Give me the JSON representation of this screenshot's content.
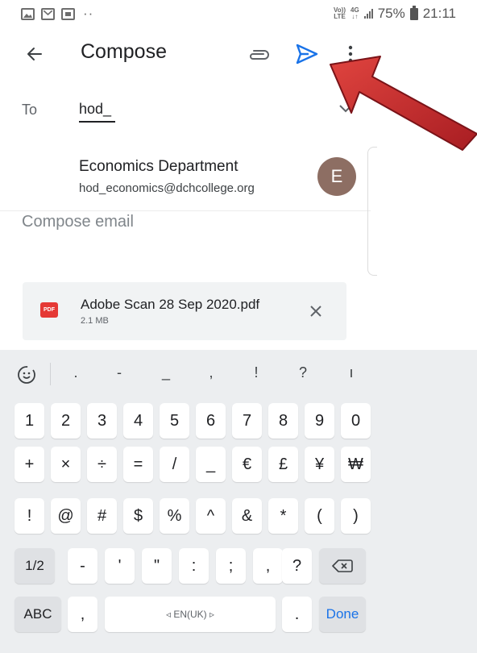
{
  "status_bar": {
    "net_tag_top": "Vo))",
    "net_tag_bottom": "LTE",
    "net_type": "4G",
    "battery": "75%",
    "time": "21:11",
    "left_icons": [
      "gallery-icon",
      "gmail-icon",
      "app-icon"
    ],
    "dots": "··"
  },
  "appbar": {
    "title": "Compose",
    "icons": [
      "back-arrow-icon",
      "paperclip-icon",
      "send-icon",
      "more-vert-icon"
    ]
  },
  "to": {
    "label": "To",
    "value": "hod_"
  },
  "suggestion": {
    "name": "Economics Department",
    "email": "hod_economics@dchcollege.org",
    "avatar_letter": "E",
    "avatar_color": "#8d6e63"
  },
  "body": {
    "placeholder": "Compose email"
  },
  "attachment": {
    "file_icon_label": "PDF",
    "name": "Adobe Scan 28 Sep 2020.pdf",
    "size": "2.1 MB"
  },
  "keyboard": {
    "suggestions": [
      ".",
      "-",
      "_",
      ",",
      "!",
      "?",
      "ı"
    ],
    "row1": [
      "1",
      "2",
      "3",
      "4",
      "5",
      "6",
      "7",
      "8",
      "9",
      "0"
    ],
    "row2": [
      "+",
      "×",
      "÷",
      "=",
      "/",
      "_",
      "€",
      "£",
      "¥",
      "₩"
    ],
    "row3": [
      "!",
      "@",
      "#",
      "$",
      "%",
      "^",
      "&",
      "*",
      "(",
      ")"
    ],
    "row4_left": "1/2",
    "row4": [
      "-",
      "'",
      "\"",
      ":",
      ";",
      ",",
      "?"
    ],
    "abc_label": "ABC",
    "comma": ",",
    "space_label": "◃ EN(UK) ▹",
    "period": ".",
    "done_label": "Done"
  },
  "colors": {
    "send_accent": "#1a73e8",
    "pdf_red": "#e53935",
    "arrow_red": "#c0262b"
  }
}
